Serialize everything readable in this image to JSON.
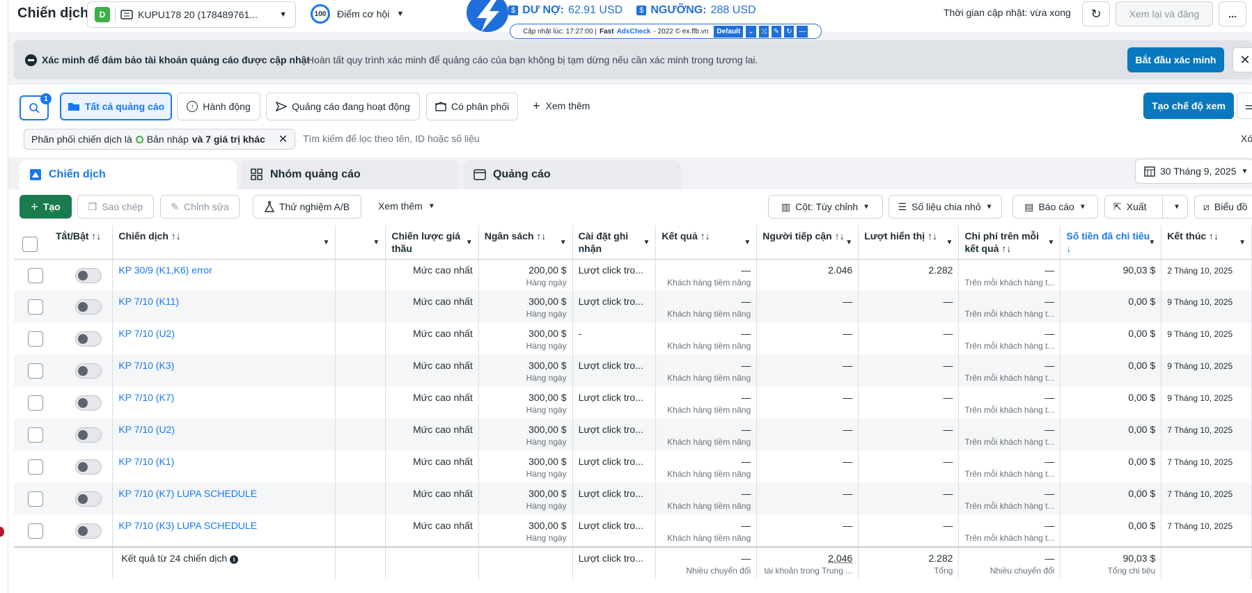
{
  "header": {
    "title": "Chiến dịch",
    "account_badge": "D",
    "account_name": "KUPU178 20 (178489761...",
    "score": "100",
    "score_label": "Điểm cơ hội",
    "updated_text": "Thời gian cập nhật: vừa xong",
    "review_publish": "Xem lại và đăng",
    "more": "..."
  },
  "ext": {
    "debt_label": "DƯ NỢ:",
    "debt_value": "62.91 USD",
    "threshold_label": "NGƯỠNG:",
    "threshold_value": "288 USD",
    "update_info": "Cập nhật lúc: 17:27:00 |",
    "brand_fast": "Fast",
    "brand_name": "AdsCheck",
    "brand_rest": "- 2022 © ex.ffb.vn",
    "mode": "Default"
  },
  "banner": {
    "title": "Xác minh để đảm bảo tài khoản quảng cáo được cập nhật",
    "body": "Hoàn tất quy trình xác minh để quảng cáo của bạn không bị tạm dừng nếu cần xác minh trong tương lai.",
    "cta": "Bắt đầu xác minh"
  },
  "filters": {
    "search_badge": "1",
    "all_ads": "Tất cả quảng cáo",
    "actions": "Hành động",
    "active_ads": "Quảng cáo đang hoạt động",
    "delivered": "Có phân phối",
    "see_more": "Xem thêm",
    "create_view": "Tạo chế độ xem",
    "chip_prefix": "Phân phối chiến dịch là",
    "chip_value": "Bản nháp",
    "chip_more": "và 7 giá trị khác",
    "search_placeholder": "Tìm kiếm để lọc theo tên, ID hoặc số liệu",
    "clear": "Xó"
  },
  "tabs": {
    "campaigns": "Chiến dịch",
    "adsets": "Nhóm quảng cáo",
    "ads": "Quảng cáo",
    "date": "30 Tháng 9, 2025"
  },
  "toolbar": {
    "create": "Tạo",
    "duplicate": "Sao chép",
    "edit": "Chỉnh sửa",
    "abtest": "Thử nghiệm A/B",
    "more": "Xem thêm",
    "columns": "Cột: Tùy chỉnh",
    "breakdown": "Số liệu chia nhỏ",
    "reports": "Báo cáo",
    "export": "Xuất",
    "charts": "Biểu đồ"
  },
  "table": {
    "headers": {
      "toggle": "Tắt/Bật ↑↓",
      "campaign": "Chiến dịch ↑↓",
      "bid": "Chiến lược giá thầu",
      "budget": "Ngân sách ↑↓",
      "attribution": "Cài đặt ghi nhận",
      "results": "Kết quả ↑↓",
      "reach": "Người tiếp cận ↑↓",
      "impressions": "Lượt hiển thị ↑↓",
      "cpr": "Chi phí trên mỗi kết quả ↑↓",
      "spent": "Số tiền đã chi tiêu ↓",
      "end": "Kết thúc ↑↓"
    },
    "rows": [
      {
        "name": "KP 30/9 (K1,K6) error",
        "bid": "Mức cao nhất",
        "budget": "200,00 $",
        "budget_sub": "Hàng ngày",
        "attribution": "Lượt click tro...",
        "result": "—",
        "result_sub": "Khách hàng tiềm năng",
        "reach": "2.046",
        "impressions": "2.282",
        "cpr": "—",
        "cpr_sub": "Trên mỗi khách hàng t...",
        "spent": "90,03 $",
        "end": "2 Tháng 10, 2025"
      },
      {
        "name": "KP 7/10 (K11)",
        "bid": "Mức cao nhất",
        "budget": "300,00 $",
        "budget_sub": "Hàng ngày",
        "attribution": "Lượt click tro...",
        "result": "—",
        "result_sub": "Khách hàng tiềm năng",
        "reach": "—",
        "impressions": "—",
        "cpr": "—",
        "cpr_sub": "Trên mỗi khách hàng t...",
        "spent": "0,00 $",
        "end": "9 Tháng 10, 2025"
      },
      {
        "name": "KP 7/10 (U2)",
        "bid": "Mức cao nhất",
        "budget": "300,00 $",
        "budget_sub": "Hàng ngày",
        "attribution": "-",
        "result": "—",
        "result_sub": "Khách hàng tiềm năng",
        "reach": "—",
        "impressions": "—",
        "cpr": "—",
        "cpr_sub": "Trên mỗi khách hàng t...",
        "spent": "0,00 $",
        "end": "9 Tháng 10, 2025"
      },
      {
        "name": "KP 7/10 (K3)",
        "bid": "Mức cao nhất",
        "budget": "300,00 $",
        "budget_sub": "Hàng ngày",
        "attribution": "Lượt click tro...",
        "result": "—",
        "result_sub": "Khách hàng tiềm năng",
        "reach": "—",
        "impressions": "—",
        "cpr": "—",
        "cpr_sub": "Trên mỗi khách hàng t...",
        "spent": "0,00 $",
        "end": "9 Tháng 10, 2025"
      },
      {
        "name": "KP 7/10 (K7)",
        "bid": "Mức cao nhất",
        "budget": "300,00 $",
        "budget_sub": "Hàng ngày",
        "attribution": "Lượt click tro...",
        "result": "—",
        "result_sub": "Khách hàng tiềm năng",
        "reach": "—",
        "impressions": "—",
        "cpr": "—",
        "cpr_sub": "Trên mỗi khách hàng t...",
        "spent": "0,00 $",
        "end": "9 Tháng 10, 2025"
      },
      {
        "name": "KP 7/10 (U2)",
        "bid": "Mức cao nhất",
        "budget": "300,00 $",
        "budget_sub": "Hàng ngày",
        "attribution": "Lượt click tro...",
        "result": "—",
        "result_sub": "Khách hàng tiềm năng",
        "reach": "—",
        "impressions": "—",
        "cpr": "—",
        "cpr_sub": "Trên mỗi khách hàng t...",
        "spent": "0,00 $",
        "end": "7 Tháng 10, 2025"
      },
      {
        "name": "KP 7/10 (K1)",
        "bid": "Mức cao nhất",
        "budget": "300,00 $",
        "budget_sub": "Hàng ngày",
        "attribution": "Lượt click tro...",
        "result": "—",
        "result_sub": "Khách hàng tiềm năng",
        "reach": "—",
        "impressions": "—",
        "cpr": "—",
        "cpr_sub": "Trên mỗi khách hàng t...",
        "spent": "0,00 $",
        "end": "7 Tháng 10, 2025"
      },
      {
        "name": "KP 7/10 (K7) LUPA SCHEDULE",
        "bid": "Mức cao nhất",
        "budget": "300,00 $",
        "budget_sub": "Hàng ngày",
        "attribution": "Lượt click tro...",
        "result": "—",
        "result_sub": "Khách hàng tiềm năng",
        "reach": "—",
        "impressions": "—",
        "cpr": "—",
        "cpr_sub": "Trên mỗi khách hàng t...",
        "spent": "0,00 $",
        "end": "7 Tháng 10, 2025"
      },
      {
        "name": "KP 7/10 (K3) LUPA SCHEDULE",
        "bid": "Mức cao nhất",
        "budget": "300,00 $",
        "budget_sub": "Hàng ngày",
        "attribution": "Lượt click tro...",
        "result": "—",
        "result_sub": "Khách hàng tiềm năng",
        "reach": "—",
        "impressions": "—",
        "cpr": "—",
        "cpr_sub": "Trên mỗi khách hàng t...",
        "spent": "0,00 $",
        "end": "7 Tháng 10, 2025"
      }
    ],
    "footer": {
      "label": "Kết quả từ 24 chiến dịch",
      "attribution": "Lượt click tro...",
      "result": "—",
      "result_sub": "Nhiều chuyển đổi",
      "reach": "2.046",
      "reach_sub": "tài khoản trong Trung ...",
      "impressions": "2.282",
      "impressions_sub": "Tổng",
      "cpr": "—",
      "cpr_sub": "Nhiều chuyển đổi",
      "spent": "90,03 $",
      "spent_sub": "Tổng chi tiêu"
    }
  }
}
